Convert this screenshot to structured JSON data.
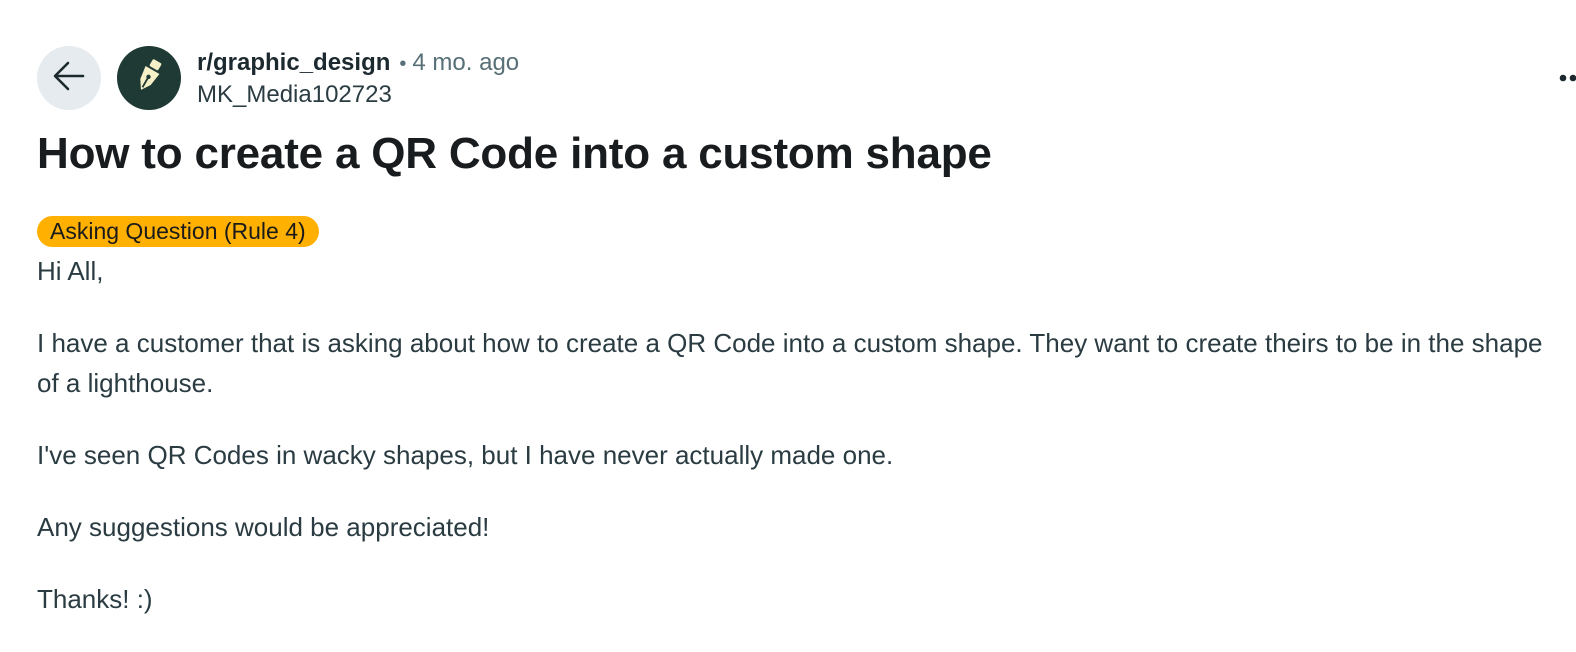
{
  "header": {
    "subreddit": "r/graphic_design",
    "separator": "•",
    "time_ago": "4 mo. ago",
    "author": "MK_Media102723"
  },
  "icons": {
    "back": "arrow-left-icon",
    "avatar": "pen-nib-icon",
    "more": "more-options-icon"
  },
  "post": {
    "title": "How to create a QR Code into a custom shape",
    "flair": "Asking Question (Rule 4)",
    "paragraphs": [
      "Hi All,",
      "I have a customer that is asking about how to create a QR Code into a custom shape. They want to create theirs to be in the shape of a lighthouse.",
      "I've seen QR Codes in wacky shapes, but I have never actually made one.",
      "Any suggestions would be appreciated!",
      "Thanks! :)"
    ]
  },
  "colors": {
    "flair_bg": "#ffb000",
    "avatar_bg": "#1f3a34",
    "back_button_bg": "#e5ebee"
  }
}
